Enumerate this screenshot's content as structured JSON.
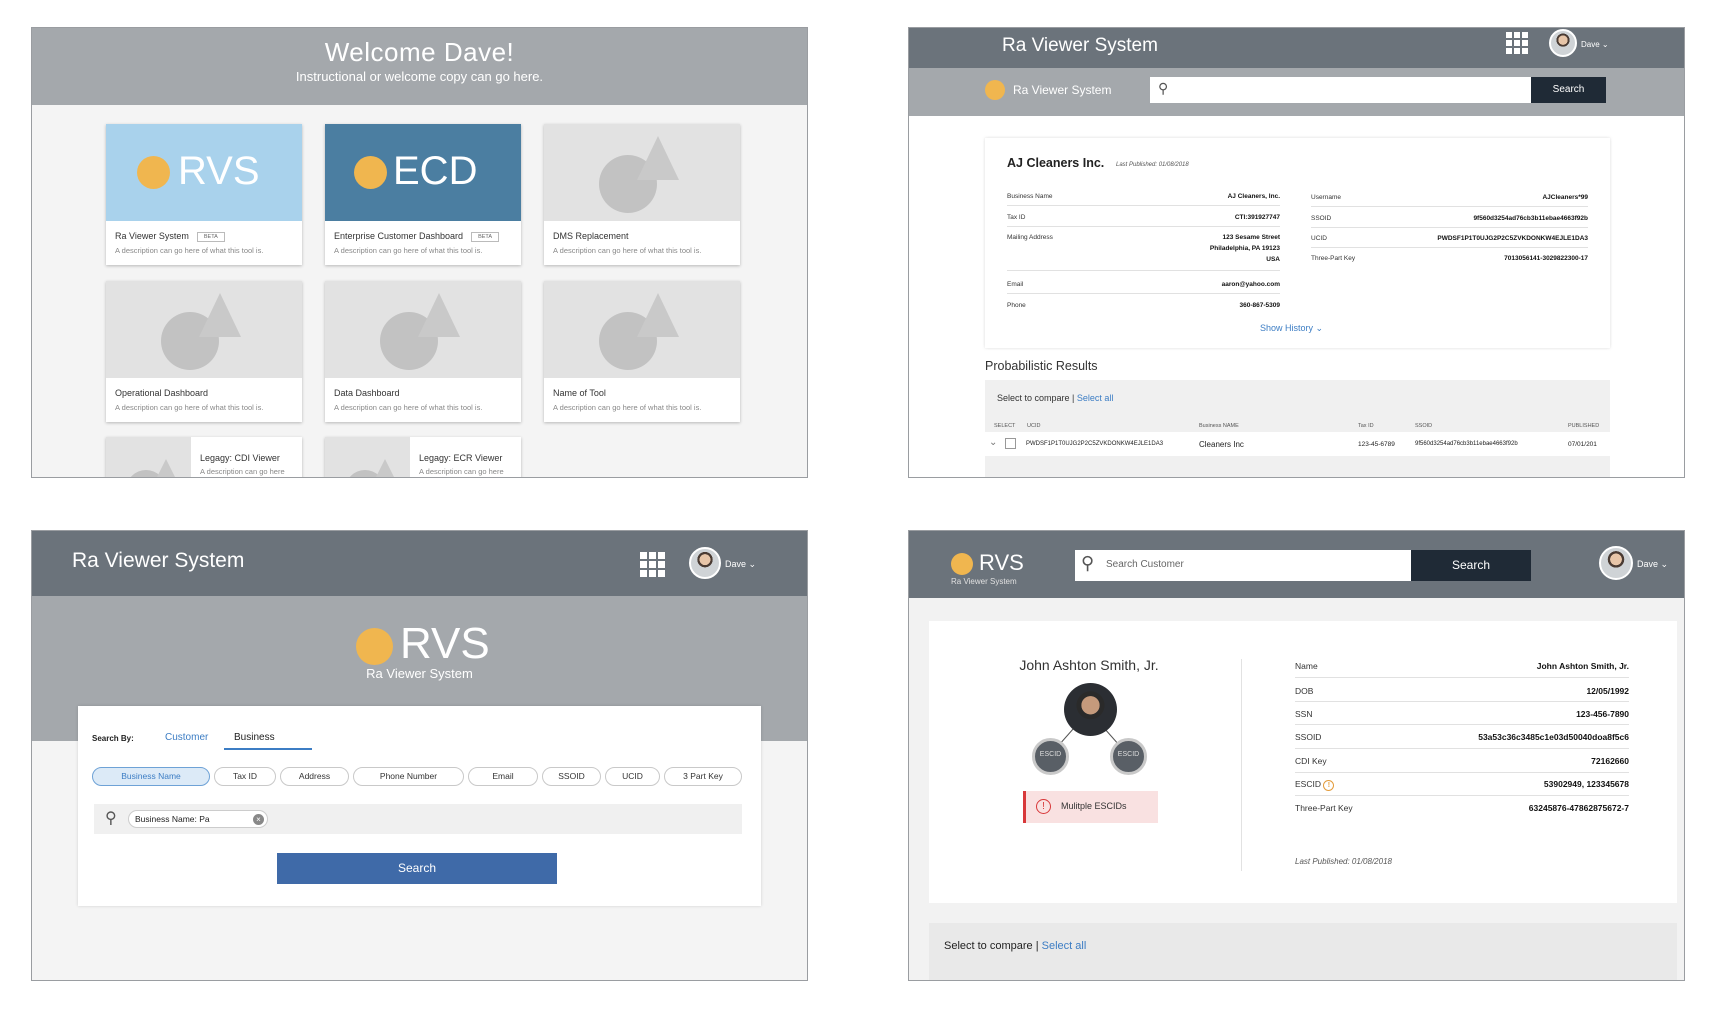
{
  "panel1": {
    "title": "Welcome Dave!",
    "subtitle": "Instructional or welcome copy can go here.",
    "cards": [
      {
        "logo": "RVS",
        "name": "Ra Viewer System",
        "badge": "BETA",
        "desc": "A description can go here of what this tool is."
      },
      {
        "logo": "ECD",
        "name": "Enterprise Customer Dashboard",
        "badge": "BETA",
        "desc": "A description can go here of what this tool is."
      },
      {
        "name": "DMS Replacement",
        "desc": "A description can go here of what this tool is."
      },
      {
        "name": "Operational Dashboard",
        "desc": "A description can go here of what this tool is."
      },
      {
        "name": "Data Dashboard",
        "desc": "A description can go here of what this tool is."
      },
      {
        "name": "Name of Tool",
        "desc": "A description can go here of what this tool is."
      }
    ],
    "legacy": [
      {
        "name": "Legagy: CDI Viewer",
        "desc": "A description can go here"
      },
      {
        "name": "Legagy: ECR Viewer",
        "desc": "A description can go here"
      }
    ],
    "colors": {
      "header": "#a4a8ac",
      "rvs_thumb": "#a9d2ec",
      "ecd_thumb": "#4b7ea1",
      "sun": "#f0b64f"
    }
  },
  "panel2": {
    "app_title": "Ra Viewer System",
    "user": "Dave",
    "brand": "Ra Viewer System",
    "search_button": "Search",
    "company": "AJ Cleaners Inc.",
    "last_published": "Last Published: 01/08/2018",
    "left_fields": [
      {
        "label": "Business Name",
        "value": "AJ Cleaners, Inc."
      },
      {
        "label": "Tax ID",
        "value": "CTI:391927747"
      },
      {
        "label": "Mailing Address",
        "value1": "123 Sesame Street",
        "value2": "Philadelphia, PA 19123",
        "value3": "USA"
      },
      {
        "label": "Email",
        "value": "aaron@yahoo.com"
      },
      {
        "label": "Phone",
        "value": "360-867-5309"
      }
    ],
    "right_fields": [
      {
        "label": "Username",
        "value": "AJCleaners*99"
      },
      {
        "label": "SSOID",
        "value": "9f560d3254ad76cb3b11ebae4663f92b"
      },
      {
        "label": "UCID",
        "value": "PWDSF1P1T0UJG2P2C5ZVKDONKW4EJLE1DA3"
      },
      {
        "label": "Three-Part Key",
        "value": "7013056141-3029822300-17"
      }
    ],
    "show_history": "Show History",
    "prob_title": "Probabilistic Results",
    "select_compare": "Select to compare |",
    "select_all": "Select all",
    "columns": [
      "SELECT",
      "UCID",
      "Business NAME",
      "Tax ID",
      "SSOID",
      "PUBLISHED"
    ],
    "row": {
      "ucid": "PWDSF1P1T0UJG2P2C5ZVKDONKW4EJLE1DA3",
      "business": "Cleaners Inc",
      "tax": "123-45-6789",
      "ssoid": "9f560d3254ad76cb3b11ebae4663f92b",
      "published": "07/01/201"
    }
  },
  "panel3": {
    "app_title": "Ra Viewer System",
    "user": "Dave",
    "logo": "RVS",
    "logo_sub": "Ra Viewer System",
    "search_by": "Search By:",
    "tabs": [
      "Customer",
      "Business"
    ],
    "chips": [
      "Business Name",
      "Tax ID",
      "Address",
      "Phone Number",
      "Email",
      "SSOID",
      "UCID",
      "3 Part Key"
    ],
    "token": "Business Name: Pa",
    "search_button": "Search"
  },
  "panel4": {
    "logo": "RVS",
    "logo_sub": "Ra Viewer System",
    "search_placeholder": "Search Customer",
    "search_button": "Search",
    "user": "Dave",
    "customer_name": "John Ashton Smith, Jr.",
    "node_label": "ESCID",
    "alert": "Mulitple ESCIDs",
    "fields": [
      {
        "label": "Name",
        "value": "John Ashton Smith, Jr."
      },
      {
        "label": "DOB",
        "value": "12/05/1992"
      },
      {
        "label": "SSN",
        "value": "123-456-7890"
      },
      {
        "label": "SSOID",
        "value": "53a53c36c3485c1e03d50040doa8f5c6"
      },
      {
        "label": "CDI Key",
        "value": "72162660"
      },
      {
        "label": "ESCID",
        "value": "53902949, 123345678"
      },
      {
        "label": "Three-Part Key",
        "value": "63245876-47862875672-7"
      }
    ],
    "last_published": "Last Published: 01/08/2018",
    "select_compare": "Select to compare |",
    "select_all": "Select all"
  }
}
